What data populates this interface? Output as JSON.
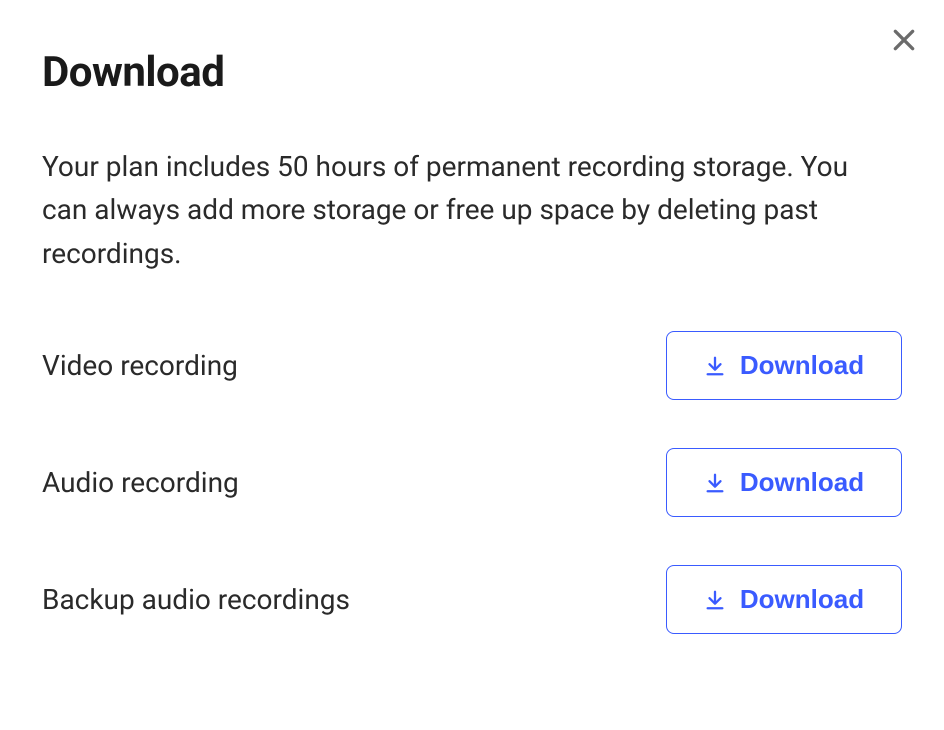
{
  "modal": {
    "title": "Download",
    "description": "Your plan includes 50 hours of permanent recording storage. You can always add more storage or free up space by deleting past recordings."
  },
  "items": [
    {
      "label": "Video recording",
      "button_label": "Download"
    },
    {
      "label": "Audio recording",
      "button_label": "Download"
    },
    {
      "label": "Backup audio recordings",
      "button_label": "Download"
    }
  ]
}
